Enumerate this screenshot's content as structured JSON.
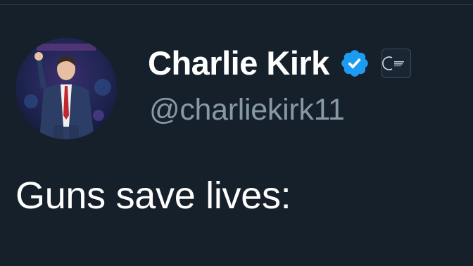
{
  "author": {
    "display_name": "Charlie Kirk",
    "handle": "@charliekirk11",
    "avatar_icon": "profile-photo",
    "verified_icon": "verified-badge-icon",
    "affiliate_icon": "affiliate-logo-icon"
  },
  "tweet": {
    "text": "Guns save lives:"
  },
  "colors": {
    "background": "#15202b",
    "name": "#ffffff",
    "handle": "#8899a6",
    "verified": "#1d9bf0"
  }
}
